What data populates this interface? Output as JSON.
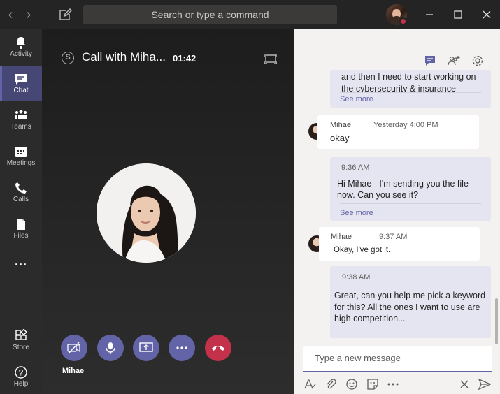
{
  "titlebar": {
    "search_placeholder": "Search or type a command",
    "back_icon": "chevron-left",
    "forward_icon": "chevron-right",
    "compose_icon": "compose",
    "minimize_icon": "minimize",
    "maximize_icon": "maximize",
    "close_icon": "close"
  },
  "rail": {
    "items": [
      {
        "label": "Activity",
        "icon": "bell-icon",
        "active": false
      },
      {
        "label": "Chat",
        "icon": "chat-icon",
        "active": true
      },
      {
        "label": "Teams",
        "icon": "teams-icon",
        "active": false
      },
      {
        "label": "Meetings",
        "icon": "calendar-icon",
        "active": false
      },
      {
        "label": "Calls",
        "icon": "phone-icon",
        "active": false
      },
      {
        "label": "Files",
        "icon": "file-icon",
        "active": false
      },
      {
        "label": "...",
        "icon": "more-icon",
        "active": false
      }
    ],
    "bottom": [
      {
        "label": "Store",
        "icon": "store-icon"
      },
      {
        "label": "Help",
        "icon": "help-icon"
      }
    ]
  },
  "call": {
    "title": "Call with Mihae",
    "title_display": "Call with Miha...",
    "duration": "01:42",
    "participant": "Mihae",
    "controls": [
      "video-off",
      "microphone",
      "share-screen",
      "more",
      "hang-up"
    ]
  },
  "chat": {
    "messages": [
      {
        "from": "me",
        "text": "and then I need to start working on the cybersecurity & insurance",
        "see_more": "See more"
      },
      {
        "from": "Mihae",
        "time": "Yesterday 4:00 PM",
        "text": "okay"
      },
      {
        "from": "me",
        "time": "9:36 AM",
        "text": "Hi Mihae - I'm sending you the file now. Can you see it?",
        "see_more": "See more"
      },
      {
        "from": "Mihae",
        "time": "9:37 AM",
        "text": "Okay, I've got it."
      },
      {
        "from": "me",
        "time": "9:38 AM",
        "text": "Great, can you help me pick a keyword for this? All the ones I want to use are high competition..."
      }
    ],
    "compose_placeholder": "Type a new message"
  },
  "colors": {
    "accent": "#6264a7",
    "hangup": "#c4314b",
    "rail_bg": "#2b2b2b",
    "chat_bg": "#f3f2f1"
  }
}
